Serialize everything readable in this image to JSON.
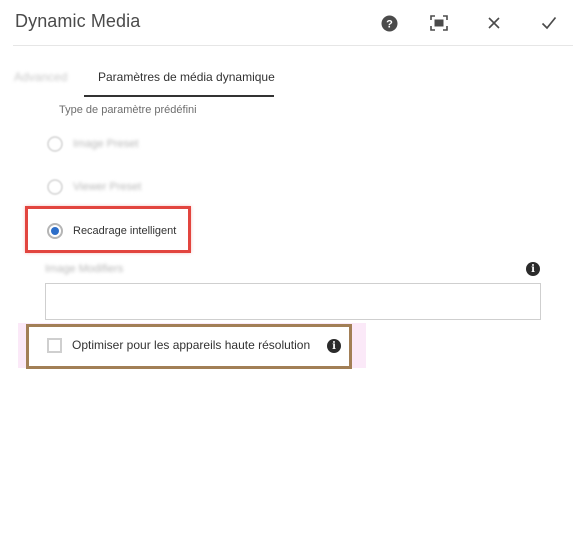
{
  "dialog": {
    "title": "Dynamic Media",
    "actions": {
      "help_icon": "help-circle-icon",
      "fullscreen_icon": "fullscreen-icon",
      "close_icon": "close-icon",
      "done_icon": "checkmark-icon"
    }
  },
  "tabs": [
    {
      "label": "Advanced",
      "active": false
    },
    {
      "label": "Paramètres de média dynamique",
      "active": true
    }
  ],
  "preset_type": {
    "label": "Type de paramètre prédéfini",
    "options": [
      {
        "label": "Image Preset",
        "checked": false
      },
      {
        "label": "Viewer Preset",
        "checked": false
      },
      {
        "label": "Recadrage intelligent",
        "checked": true
      }
    ]
  },
  "image_modifiers": {
    "label": "Image Modifiers",
    "value": "",
    "info_icon": "info-icon"
  },
  "hi_res": {
    "label": "Optimiser pour les appareils haute résolution",
    "checked": false,
    "info_icon": "info-icon"
  },
  "colors": {
    "selected_radio": "#2d6ec9",
    "highlight_red": "#e2453f",
    "highlight_gold": "#a27f56",
    "halo_pink": "#fbe9f8"
  }
}
